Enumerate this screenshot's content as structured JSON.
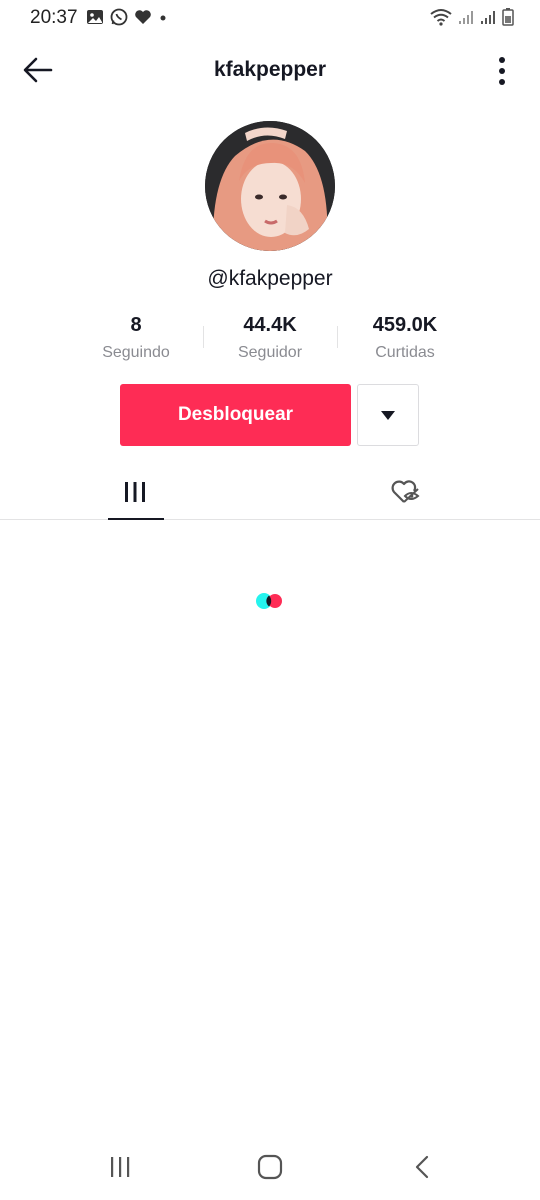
{
  "status_bar": {
    "time": "20:37"
  },
  "header": {
    "title": "kfakpepper"
  },
  "profile": {
    "handle": "@kfakpepper",
    "stats": [
      {
        "value": "8",
        "label": "Seguindo"
      },
      {
        "value": "44.4K",
        "label": "Seguidor"
      },
      {
        "value": "459.0K",
        "label": "Curtidas"
      }
    ]
  },
  "actions": {
    "unblock_label": "Desbloquear"
  },
  "tabs": [
    {
      "icon": "videos-grid-icon",
      "active": true
    },
    {
      "icon": "liked-hidden-icon",
      "active": false
    }
  ],
  "colors": {
    "accent": "#fe2c55",
    "loader_cyan": "#25f4ee",
    "loader_red": "#fe2c55",
    "text_primary": "#161823",
    "text_secondary": "#8a8b91"
  }
}
